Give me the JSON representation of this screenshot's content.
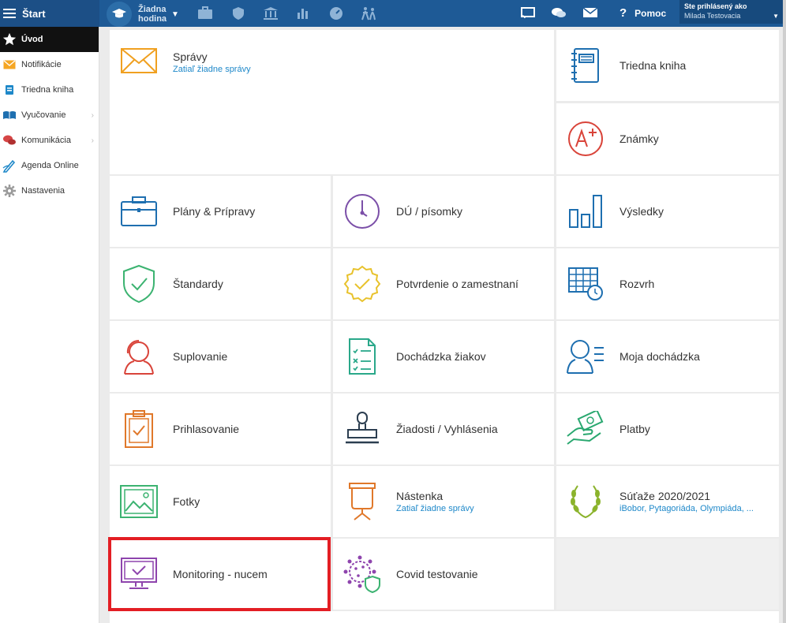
{
  "header": {
    "start_label": "Štart",
    "hour_label": "Žiadna hodina",
    "help_label": "Pomoc",
    "user_caption": "Ste prihlásený ako",
    "user_name": "Milada Testovacia"
  },
  "sidebar": {
    "items": [
      {
        "label": "Úvod",
        "icon": "star-icon"
      },
      {
        "label": "Notifikácie",
        "icon": "envelope-icon"
      },
      {
        "label": "Triedna kniha",
        "icon": "book-icon"
      },
      {
        "label": "Vyučovanie",
        "icon": "open-book-icon"
      },
      {
        "label": "Komunikácia",
        "icon": "chat-icon"
      },
      {
        "label": "Agenda Online",
        "icon": "pen-icon"
      },
      {
        "label": "Nastavenia",
        "icon": "gear-icon"
      }
    ]
  },
  "tiles": {
    "spravy": {
      "name": "Správy",
      "sub": "Zatiaľ žiadne správy"
    },
    "triedna_kniha": {
      "name": "Triedna kniha"
    },
    "znamky": {
      "name": "Známky"
    },
    "plany": {
      "name": "Plány & Prípravy"
    },
    "du": {
      "name": "DÚ / písomky"
    },
    "vysledky": {
      "name": "Výsledky"
    },
    "standardy": {
      "name": "Štandardy"
    },
    "potvrdenie": {
      "name": "Potvrdenie o zamestnaní"
    },
    "rozvrh": {
      "name": "Rozvrh"
    },
    "suplovanie": {
      "name": "Suplovanie"
    },
    "dochadzka_ziakov": {
      "name": "Dochádzka žiakov"
    },
    "moja_dochadzka": {
      "name": "Moja dochádzka"
    },
    "prihlasovanie": {
      "name": "Prihlasovanie"
    },
    "ziadosti": {
      "name": "Žiadosti / Vyhlásenia"
    },
    "platby": {
      "name": "Platby"
    },
    "fotky": {
      "name": "Fotky"
    },
    "nastenka": {
      "name": "Nástenka",
      "sub": "Zatiaľ žiadne správy"
    },
    "sutaze": {
      "name": "Súťaže 2020/2021",
      "sub": "iBobor, Pytagoriáda, Olympiáda, ..."
    },
    "monitoring": {
      "name": "Monitoring - nucem"
    },
    "covid": {
      "name": "Covid testovanie"
    }
  },
  "colors": {
    "topbar": "#1e5a96",
    "highlight": "#e31e24",
    "link": "#1e88c9"
  }
}
